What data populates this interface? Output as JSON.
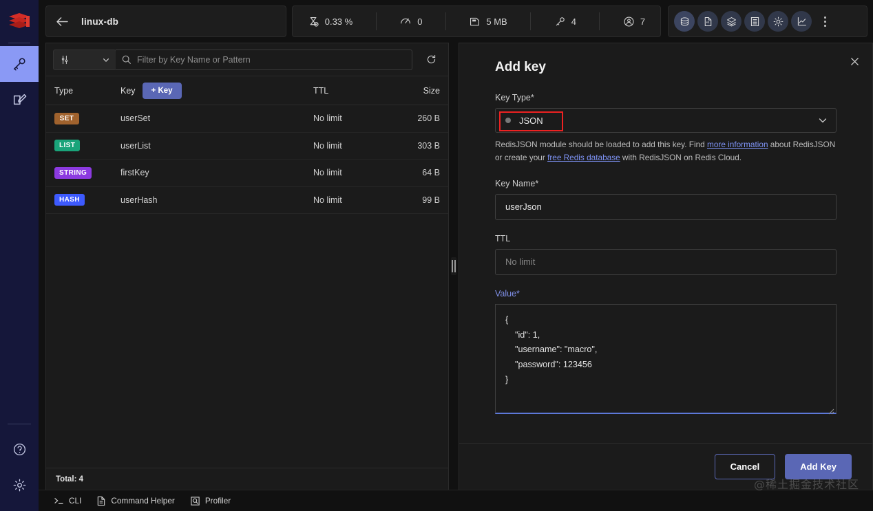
{
  "sidebar": {
    "logo": "redis-logo",
    "items": [
      {
        "name": "browser",
        "icon": "key-icon",
        "active": true
      },
      {
        "name": "workbench",
        "icon": "edit-square-icon",
        "active": false
      }
    ],
    "bottom_items": [
      {
        "name": "help",
        "icon": "question-circle-icon"
      },
      {
        "name": "settings",
        "icon": "gear-icon"
      }
    ]
  },
  "topbar": {
    "back_label": "back-arrow",
    "db_name": "linux-db",
    "stats": [
      {
        "icon": "hourglass-icon",
        "value": "0.33 %"
      },
      {
        "icon": "gauge-icon",
        "value": "0"
      },
      {
        "icon": "memory-card-icon",
        "value": "5 MB"
      },
      {
        "icon": "key-icon",
        "value": "4"
      },
      {
        "icon": "user-circle-icon",
        "value": "7"
      }
    ],
    "tools": [
      {
        "name": "database-stack-icon",
        "selected": true
      },
      {
        "name": "slowlog-document-icon",
        "selected": false
      },
      {
        "name": "layers-icon",
        "selected": false
      },
      {
        "name": "table-grid-icon",
        "selected": false
      },
      {
        "name": "gear-icon",
        "selected": false
      },
      {
        "name": "analytics-chart-icon",
        "selected": false
      }
    ],
    "overflow_menu": "more-vertical-icon"
  },
  "keys_panel": {
    "filter_selector_icon": "sliders-icon",
    "filter_chevron_icon": "chevron-down-icon",
    "search_icon": "search-icon",
    "search_placeholder": "Filter by Key Name or Pattern",
    "search_value": "",
    "refresh_icon": "refresh-icon",
    "columns": [
      "Type",
      "Key",
      "TTL",
      "Size"
    ],
    "add_key_label": "+ Key",
    "rows": [
      {
        "type": "SET",
        "type_class": "b-set",
        "key": "userSet",
        "ttl": "No limit",
        "size": "260 B"
      },
      {
        "type": "LIST",
        "type_class": "b-list",
        "key": "userList",
        "ttl": "No limit",
        "size": "303 B"
      },
      {
        "type": "STRING",
        "type_class": "b-string",
        "key": "firstKey",
        "ttl": "No limit",
        "size": "64 B"
      },
      {
        "type": "HASH",
        "type_class": "b-hash",
        "key": "userHash",
        "ttl": "No limit",
        "size": "99 B"
      }
    ],
    "total_label": "Total: 4"
  },
  "add_key_panel": {
    "title": "Add key",
    "close_icon": "close-icon",
    "key_type_label": "Key Type*",
    "key_type_value": "JSON",
    "key_type_chevron": "chevron-down-icon",
    "hint_part1": "RedisJSON module should be loaded to add this key. Find ",
    "hint_link1": "more information",
    "hint_part2": " about RedisJSON or create your ",
    "hint_link2": "free Redis database",
    "hint_part3": " with RedisJSON on Redis Cloud.",
    "key_name_label": "Key Name*",
    "key_name_value": "userJson",
    "ttl_label": "TTL",
    "ttl_value": "",
    "ttl_placeholder": "No limit",
    "value_label": "Value*",
    "value_content": "{\n    \"id\": 1,\n    \"username\": \"macro\",\n    \"password\": 123456\n}",
    "cancel_label": "Cancel",
    "submit_label": "Add Key"
  },
  "bottombar": {
    "items": [
      {
        "label": "CLI",
        "icon": "terminal-icon"
      },
      {
        "label": "Command Helper",
        "icon": "document-icon"
      },
      {
        "label": "Profiler",
        "icon": "magnifier-square-icon"
      }
    ]
  },
  "watermark": "@稀土掘金技术社区",
  "colors": {
    "accent": "#5a67b5",
    "panel_bg": "#1b1b1b",
    "rail_bg": "#15173a",
    "rail_active": "#8a99f5",
    "annotation_red": "#ee2222",
    "link_blue": "#7e93f5",
    "badge_set": "#a0622d",
    "badge_list": "#1aa47a",
    "badge_string": "#8c3ae0",
    "badge_hash": "#3d5afe"
  }
}
